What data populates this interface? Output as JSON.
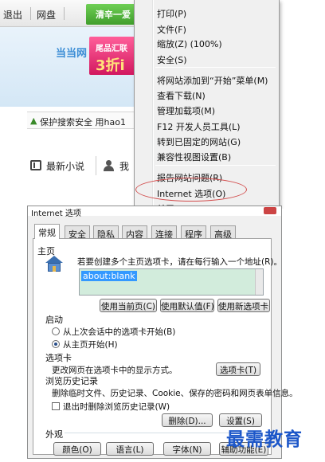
{
  "browser": {
    "toolbar": {
      "exit_label": "退出",
      "netdisk_label": "网盘",
      "green_button_label": "清辛一爱"
    },
    "ad": {
      "logo_text": "当当网",
      "banner_top": "尾品汇联",
      "banner_big": "3折i"
    },
    "search_strip": {
      "text": "保护搜索安全 用hao1"
    },
    "links": {
      "novel_label": "最新小说",
      "people_label": "我"
    }
  },
  "tools_menu": {
    "items": [
      "打印(P)",
      "文件(F)",
      "缩放(Z) (100%)",
      "安全(S)",
      "将网站添加到“开始”菜单(M)",
      "查看下载(N)",
      "管理加载项(M)",
      "F12 开发人员工具(L)",
      "转到已固定的网站(G)",
      "兼容性视图设置(B)",
      "报告网站问题(R)",
      "Internet 选项(O)",
      "关于 Internet Explorer(A)"
    ],
    "highlighted_item": "Internet 选项(O)",
    "highlight_color": "#d24b4b"
  },
  "dialog": {
    "title": "Internet 选项",
    "tabs": [
      "常规",
      "安全",
      "隐私",
      "内容",
      "连接",
      "程序",
      "高级"
    ],
    "active_tab": "常规",
    "home_page": {
      "section_label": "主页",
      "description": "若要创建多个主页选项卡，请在每行输入一个地址(R)。",
      "url_value": "about:blank",
      "use_current_button": "使用当前页(C)",
      "use_default_button": "使用默认值(F)",
      "use_new_tab_button": "使用新选项卡(U)"
    },
    "startup": {
      "section_label": "启动",
      "option_last_session": "从上次会话中的选项卡开始(B)",
      "option_home_page": "从主页开始(H)",
      "selected": "从主页开始(H)"
    },
    "tabs_section": {
      "section_label": "选项卡",
      "description": "更改网页在选项卡中的显示方式。",
      "button": "选项卡(T)"
    },
    "history": {
      "section_label": "浏览历史记录",
      "description": "删除临时文件、历史记录、Cookie、保存的密码和网页表单信息。",
      "checkbox_label": "退出时删除浏览历史记录(W)",
      "checkbox_checked": false,
      "delete_button": "删除(D)...",
      "settings_button": "设置(S)"
    },
    "appearance": {
      "section_label": "外观",
      "colors_button": "颜色(O)",
      "languages_button": "语言(L)",
      "fonts_button": "字体(N)",
      "accessibility_button": "辅助功能(E)"
    }
  },
  "watermark": {
    "text": "最需教育",
    "color": "#1d57c9"
  }
}
